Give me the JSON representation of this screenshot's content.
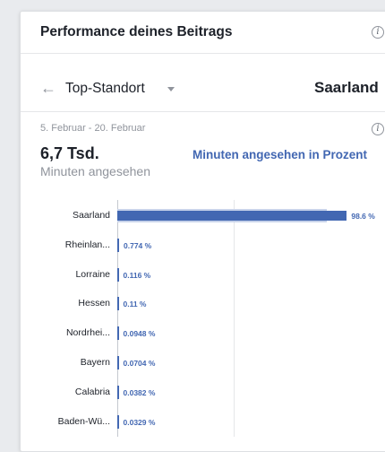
{
  "header": {
    "title": "Performance deines Beitrags",
    "info_icon": "info-icon"
  },
  "filter": {
    "back_icon": "arrow-left-icon",
    "back_glyph": "←",
    "dropdown_label": "Top-Standort",
    "region": "Saarland"
  },
  "summary": {
    "date_range": "5. Februar - 20. Februar",
    "value": "6,7 Tsd.",
    "caption": "Minuten angesehen",
    "metric_link": "Minuten angesehen in Prozent"
  },
  "colors": {
    "accent": "#4267b2",
    "bar_back": "#c8d3ea",
    "text": "#1d2129",
    "muted": "#90949c"
  },
  "chart_data": {
    "type": "bar",
    "orientation": "horizontal",
    "categories": [
      "Saarland",
      "Rheinlan...",
      "Lorraine",
      "Hessen",
      "Nordrhei...",
      "Bayern",
      "Calabria",
      "Baden-Wü..."
    ],
    "values": [
      98.6,
      0.774,
      0.116,
      0.11,
      0.0948,
      0.0704,
      0.0382,
      0.0329
    ],
    "value_labels": [
      "98.6 %",
      "0.774 %",
      "0.116 %",
      "0.11 %",
      "0.0948 %",
      "0.0704 %",
      "0.0382 %",
      "0.0329 %"
    ],
    "xlim": [
      0,
      100
    ],
    "grid": true
  }
}
